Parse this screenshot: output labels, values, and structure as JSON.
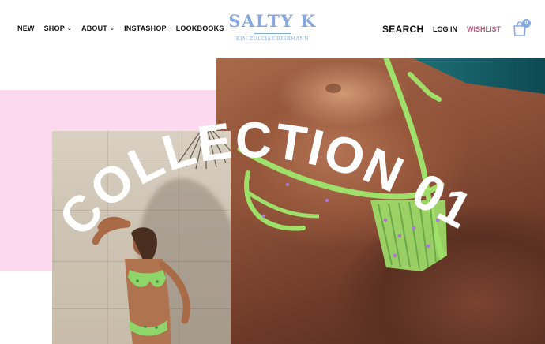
{
  "header": {
    "nav": [
      {
        "label": "NEW",
        "has_dropdown": false
      },
      {
        "label": "SHOP",
        "has_dropdown": true
      },
      {
        "label": "ABOUT",
        "has_dropdown": true
      },
      {
        "label": "INSTASHOP",
        "has_dropdown": false
      },
      {
        "label": "LOOKBOOKS",
        "has_dropdown": false
      }
    ],
    "logo": {
      "title": "SALTY K",
      "subtitle": "KIM ZOLCIAK-BIERMANN"
    },
    "search_label": "SEARCH",
    "login_label": "LOG IN",
    "wishlist_label": "WISHLIST",
    "cart_count": "0",
    "chevron_glyph": "⌄"
  },
  "hero": {
    "headline": "COLLECTION 01"
  },
  "colors": {
    "brand_blue": "#86a8df",
    "wishlist_pink": "#b0587b",
    "pink_block": "#fdd9f0",
    "bikini_green": "#9ee06a"
  },
  "icons": {
    "cart": "shopping-bag-icon",
    "chevron": "chevron-down-icon"
  }
}
